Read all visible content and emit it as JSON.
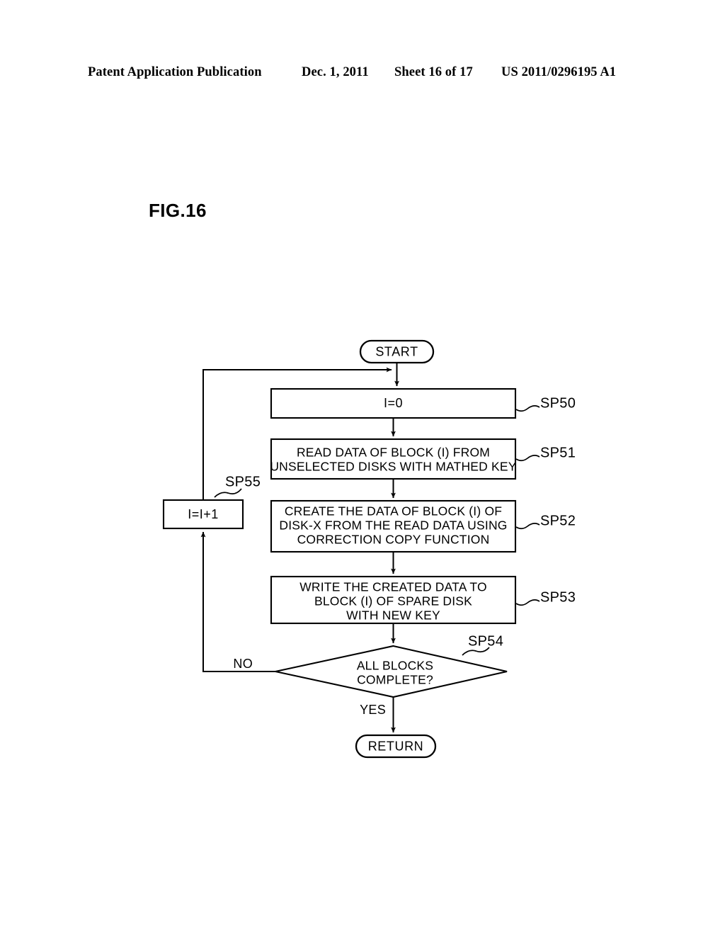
{
  "header": {
    "publication": "Patent Application Publication",
    "date": "Dec. 1, 2011",
    "sheet": "Sheet 16 of 17",
    "document_number": "US 2011/0296195 A1"
  },
  "figure": {
    "title": "FIG.16"
  },
  "flowchart": {
    "start": {
      "label": "START"
    },
    "end": {
      "label": "RETURN"
    },
    "steps": [
      {
        "id": "SP50",
        "ref": "SP50",
        "shape": "process",
        "lines": [
          "I=0"
        ]
      },
      {
        "id": "SP51",
        "ref": "SP51",
        "shape": "process",
        "lines": [
          "READ DATA OF BLOCK (I) FROM",
          "UNSELECTED DISKS WITH MATHED KEY"
        ]
      },
      {
        "id": "SP52",
        "ref": "SP52",
        "shape": "process",
        "lines": [
          "CREATE THE DATA OF BLOCK (I) OF",
          "DISK-X FROM THE READ DATA USING",
          "CORRECTION COPY FUNCTION"
        ]
      },
      {
        "id": "SP53",
        "ref": "SP53",
        "shape": "process",
        "lines": [
          "WRITE THE CREATED DATA TO",
          "BLOCK (I) OF SPARE DISK",
          "WITH NEW KEY"
        ]
      },
      {
        "id": "SP54",
        "ref": "SP54",
        "shape": "decision",
        "lines": [
          "ALL BLOCKS",
          "COMPLETE?"
        ]
      },
      {
        "id": "SP55",
        "ref": "SP55",
        "shape": "process",
        "lines": [
          "I=I+1"
        ]
      }
    ],
    "branches": {
      "no": "NO",
      "yes": "YES"
    }
  },
  "colors": {
    "ink": "#000000",
    "paper": "#ffffff"
  }
}
